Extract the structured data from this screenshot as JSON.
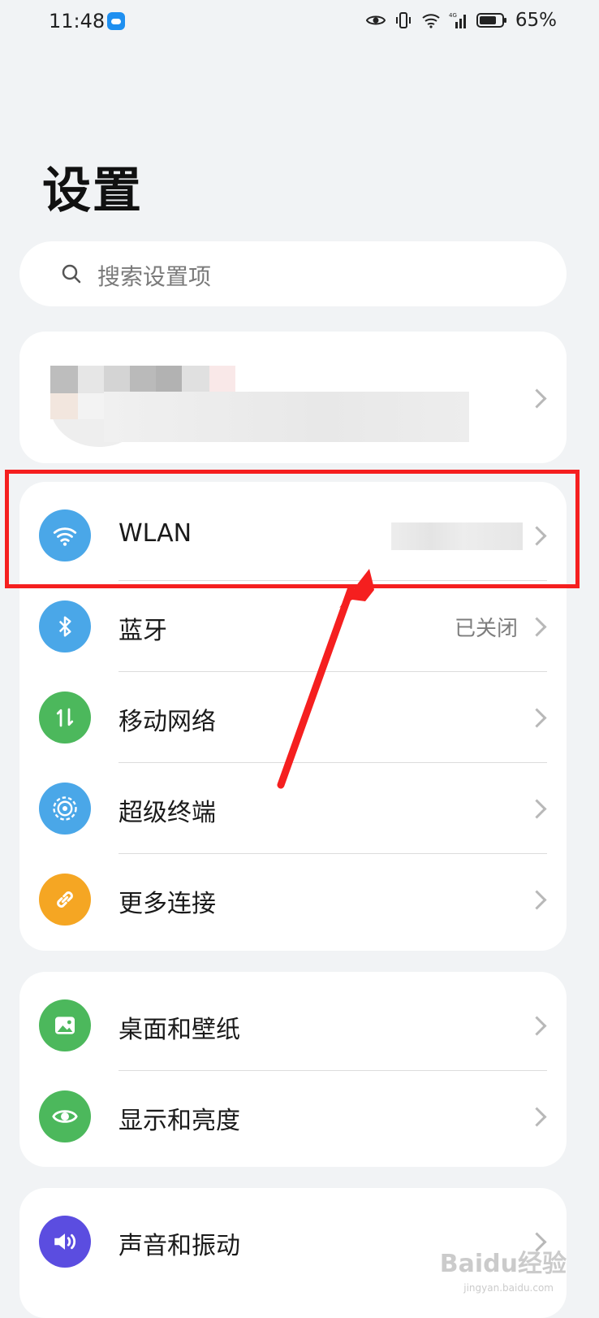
{
  "status_bar": {
    "time": "11:48",
    "battery": "65%",
    "network": "4G"
  },
  "page": {
    "title": "设置"
  },
  "search": {
    "placeholder": "搜索设置项"
  },
  "network_items": [
    {
      "label": "WLAN",
      "value": "",
      "icon": "wifi-icon",
      "color": "#4aa7e8"
    },
    {
      "label": "蓝牙",
      "value": "已关闭",
      "icon": "bluetooth-icon",
      "color": "#4aa7e8"
    },
    {
      "label": "移动网络",
      "value": "",
      "icon": "mobile-data-icon",
      "color": "#4cb85c"
    },
    {
      "label": "超级终端",
      "value": "",
      "icon": "super-device-icon",
      "color": "#4aa7e8"
    },
    {
      "label": "更多连接",
      "value": "",
      "icon": "link-icon",
      "color": "#f5a623"
    }
  ],
  "display_items": [
    {
      "label": "桌面和壁纸",
      "icon": "wallpaper-icon",
      "color": "#4cb85c"
    },
    {
      "label": "显示和亮度",
      "icon": "eye-icon",
      "color": "#4cb85c"
    }
  ],
  "sound_items": [
    {
      "label": "声音和振动",
      "icon": "speaker-icon",
      "color": "#5b4de0"
    }
  ],
  "watermark": {
    "brand": "Baidu经验",
    "url": "jingyan.baidu.com"
  }
}
